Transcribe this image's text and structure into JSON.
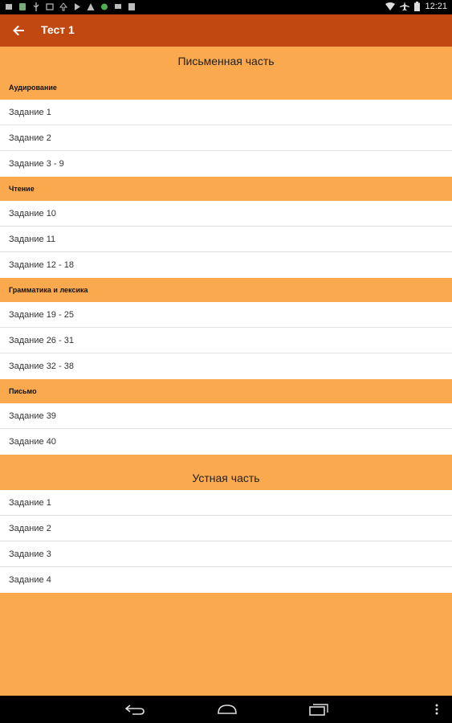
{
  "status_bar": {
    "time": "12:21"
  },
  "app_bar": {
    "title": "Тест 1"
  },
  "written_part": {
    "title": "Письменная часть",
    "sections": [
      {
        "title": "Аудирование",
        "items": [
          "Задание 1",
          "Задание 2",
          "Задание 3 - 9"
        ]
      },
      {
        "title": "Чтение",
        "items": [
          "Задание 10",
          "Задание 11",
          "Задание 12 - 18"
        ]
      },
      {
        "title": "Грамматика и лексика",
        "items": [
          "Задание 19 - 25",
          "Задание 26 - 31",
          "Задание 32 - 38"
        ]
      },
      {
        "title": "Письмо",
        "items": [
          "Задание 39",
          "Задание 40"
        ]
      }
    ]
  },
  "oral_part": {
    "title": "Устная часть",
    "items": [
      "Задание 1",
      "Задание 2",
      "Задание 3",
      "Задание 4"
    ]
  },
  "colors": {
    "app_bar": "#C14911",
    "section_bg": "#FBA94F",
    "list_bg": "#FFFFFF"
  }
}
